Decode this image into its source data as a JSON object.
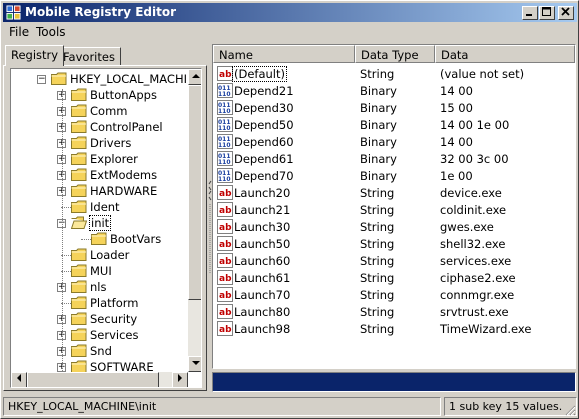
{
  "window": {
    "title": "Mobile Registry Editor"
  },
  "menu": [
    "File",
    "Tools"
  ],
  "tabs": {
    "registry": "Registry",
    "favorites": "Favorites"
  },
  "tree": [
    {
      "label": "HKEY_LOCAL_MACHINE",
      "level": 0,
      "expander": "minus"
    },
    {
      "label": "ButtonApps",
      "level": 1,
      "expander": "plus"
    },
    {
      "label": "Comm",
      "level": 1,
      "expander": "plus"
    },
    {
      "label": "ControlPanel",
      "level": 1,
      "expander": "plus"
    },
    {
      "label": "Drivers",
      "level": 1,
      "expander": "plus"
    },
    {
      "label": "Explorer",
      "level": 1,
      "expander": "plus"
    },
    {
      "label": "ExtModems",
      "level": 1,
      "expander": "plus"
    },
    {
      "label": "HARDWARE",
      "level": 1,
      "expander": "plus"
    },
    {
      "label": "Ident",
      "level": 1,
      "expander": "none"
    },
    {
      "label": "init",
      "level": 1,
      "expander": "minus",
      "open": true,
      "selected": true
    },
    {
      "label": "BootVars",
      "level": 2,
      "expander": "none"
    },
    {
      "label": "Loader",
      "level": 1,
      "expander": "none"
    },
    {
      "label": "MUI",
      "level": 1,
      "expander": "none"
    },
    {
      "label": "nls",
      "level": 1,
      "expander": "plus"
    },
    {
      "label": "Platform",
      "level": 1,
      "expander": "none"
    },
    {
      "label": "Security",
      "level": 1,
      "expander": "plus"
    },
    {
      "label": "Services",
      "level": 1,
      "expander": "plus"
    },
    {
      "label": "Snd",
      "level": 1,
      "expander": "plus"
    },
    {
      "label": "SOFTWARE",
      "level": 1,
      "expander": "plus"
    }
  ],
  "list": {
    "columns": [
      "Name",
      "Data Type",
      "Data"
    ],
    "rows": [
      {
        "icon": "string-value-icon",
        "name": "(Default)",
        "type": "String",
        "data": "(value not set)",
        "focused": true
      },
      {
        "icon": "binary-value-icon",
        "name": "Depend21",
        "type": "Binary",
        "data": "14 00"
      },
      {
        "icon": "binary-value-icon",
        "name": "Depend30",
        "type": "Binary",
        "data": "15 00"
      },
      {
        "icon": "binary-value-icon",
        "name": "Depend50",
        "type": "Binary",
        "data": "14 00 1e 00"
      },
      {
        "icon": "binary-value-icon",
        "name": "Depend60",
        "type": "Binary",
        "data": "14 00"
      },
      {
        "icon": "binary-value-icon",
        "name": "Depend61",
        "type": "Binary",
        "data": "32 00 3c 00"
      },
      {
        "icon": "binary-value-icon",
        "name": "Depend70",
        "type": "Binary",
        "data": "1e 00"
      },
      {
        "icon": "string-value-icon",
        "name": "Launch20",
        "type": "String",
        "data": "device.exe"
      },
      {
        "icon": "string-value-icon",
        "name": "Launch21",
        "type": "String",
        "data": "coldinit.exe"
      },
      {
        "icon": "string-value-icon",
        "name": "Launch30",
        "type": "String",
        "data": "gwes.exe"
      },
      {
        "icon": "string-value-icon",
        "name": "Launch50",
        "type": "String",
        "data": "shell32.exe"
      },
      {
        "icon": "string-value-icon",
        "name": "Launch60",
        "type": "String",
        "data": "services.exe"
      },
      {
        "icon": "string-value-icon",
        "name": "Launch61",
        "type": "String",
        "data": "ciphase2.exe"
      },
      {
        "icon": "string-value-icon",
        "name": "Launch70",
        "type": "String",
        "data": "connmgr.exe"
      },
      {
        "icon": "string-value-icon",
        "name": "Launch80",
        "type": "String",
        "data": "srvtrust.exe"
      },
      {
        "icon": "string-value-icon",
        "name": "Launch98",
        "type": "String",
        "data": "TimeWizard.exe"
      }
    ]
  },
  "status": {
    "path": "HKEY_LOCAL_MACHINE\\init",
    "summary": "1 sub key 15 values."
  },
  "colors": {
    "titlebar_start": "#0a246a",
    "titlebar_end": "#a6caf0",
    "selection": "#0a246a",
    "folder": "#f5d35a"
  }
}
